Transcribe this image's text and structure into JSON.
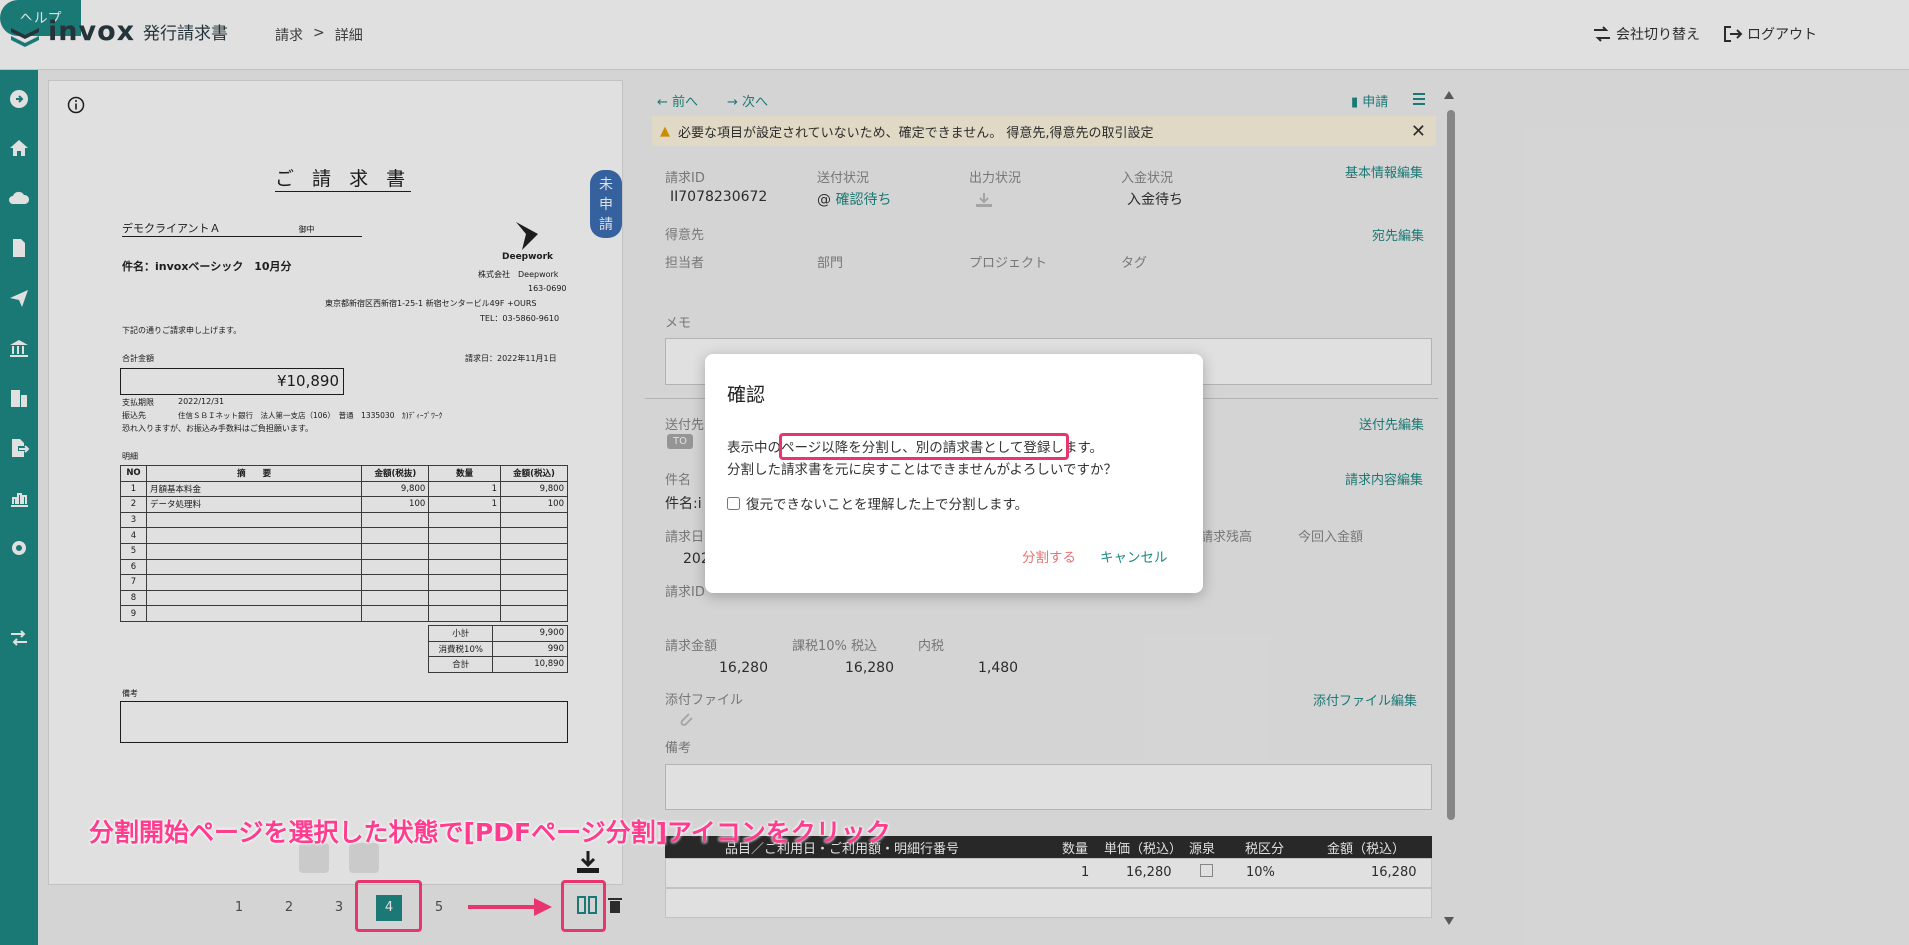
{
  "header": {
    "brand": "invox",
    "brand_sub": "発行請求書",
    "breadcrumb": [
      "請求",
      ">",
      "詳細"
    ],
    "switch_company": "会社切り替え",
    "logout": "ログアウト",
    "help": "ヘルプ"
  },
  "preview": {
    "status_badge": "未申請",
    "doc": {
      "title": "ご 請 求 書",
      "client": "デモクライアントＡ",
      "honorific": "御中",
      "subject": "件名：invoxベーシック　10月分",
      "company_logo": "Deepwork",
      "company_name": "株式会社　Deepwork",
      "postal": "163-0690",
      "address": "東京都新宿区西新宿1-25-1 新宿センタービル49F +OURS",
      "tel": "TEL：03-5860-9610",
      "intro": "下記の通りご請求申し上げます。",
      "total_label": "合計金額",
      "issue_date": "請求日：2022年11月1日",
      "total_amount": "¥10,890",
      "due_label": "支払期限",
      "due_date": "2022/12/31",
      "bank_label": "振込先",
      "bank_info": "住信ＳＢＩネット銀行　法人第一支店（106）　普通　1335030　ｶ)ﾃﾞｨｰﾌﾟﾜｰｸ",
      "fee_note": "恐れ入りますが、お振込み手数料はご負担願います。",
      "detail_label": "明細",
      "table_headers": [
        "NO",
        "摘　　要",
        "金額(税抜)",
        "数量",
        "金額(税込)"
      ],
      "rows": [
        [
          "1",
          "月額基本料金",
          "9,800",
          "1",
          "9,800"
        ],
        [
          "2",
          "データ処理料",
          "100",
          "1",
          "100"
        ],
        [
          "3",
          "",
          "",
          "",
          ""
        ],
        [
          "4",
          "",
          "",
          "",
          ""
        ],
        [
          "5",
          "",
          "",
          "",
          ""
        ],
        [
          "6",
          "",
          "",
          "",
          ""
        ],
        [
          "7",
          "",
          "",
          "",
          ""
        ],
        [
          "8",
          "",
          "",
          "",
          ""
        ],
        [
          "9",
          "",
          "",
          "",
          ""
        ]
      ],
      "summary": [
        [
          "小計",
          "9,900"
        ],
        [
          "消費税10%",
          "990"
        ],
        [
          "合計",
          "10,890"
        ]
      ],
      "remarks_label": "備考"
    },
    "pages": [
      "1",
      "2",
      "3",
      "4",
      "5"
    ],
    "active_page": "4"
  },
  "right": {
    "prev": "前へ",
    "next": "次へ",
    "apply": "申請",
    "warning": "必要な項目が設定されていないため、確定できません。 得意先,得意先の取引設定",
    "fields": {
      "invoice_id_label": "請求ID",
      "invoice_id": "II7078230672",
      "send_status_label": "送付状況",
      "send_status": "確認待ち",
      "output_status_label": "出力状況",
      "payment_status_label": "入金状況",
      "payment_status": "入金待ち",
      "edit_basic": "基本情報編集",
      "customer_label": "得意先",
      "edit_recipient": "宛先編集",
      "person_label": "担当者",
      "department_label": "部門",
      "project_label": "プロジェクト",
      "tag_label": "タグ",
      "memo_label": "メモ",
      "send_to_label": "送付先",
      "to_badge": "TO",
      "edit_send_to": "送付先編集",
      "subject_label": "件名",
      "subject_value": "件名:i",
      "edit_invoice": "請求内容編集",
      "invoice_date_label": "請求日",
      "invoice_date_value": "202",
      "balance_label": "請求残高",
      "this_payment_label": "今回入金額",
      "invoice_id2_label": "請求ID",
      "amount_label": "請求金額",
      "amount": "16,280",
      "tax10_label": "課税10% 税込",
      "tax10": "16,280",
      "inner_tax_label": "内税",
      "inner_tax": "1,480",
      "attach_label": "添付ファイル",
      "edit_attach": "添付ファイル編集",
      "remarks_label": "備考"
    },
    "table": {
      "headers": [
        "品目／ご利用日・ご利用額・明細行番号",
        "数量",
        "単価（税込）",
        "源泉",
        "税区分",
        "金額（税込）"
      ],
      "row": [
        "",
        "1",
        "16,280",
        "",
        "10%",
        "16,280"
      ]
    }
  },
  "modal": {
    "title": "確認",
    "line1_pre": "表示中の",
    "line1_highlight": "ページ以降を分割し、別の請求書として登録",
    "line1_post": "します。",
    "line2": "分割した請求書を元に戻すことはできませんがよろしいですか？",
    "checkbox_label": "復元できないことを理解した上で分割します。",
    "split_button": "分割する",
    "cancel_button": "キャンセル"
  },
  "annotation": {
    "caption": "分割開始ページを選択した状態で[PDFページ分割]アイコンをクリック"
  },
  "colors": {
    "teal": "#1f8a86",
    "badge_blue": "#3d6fb6",
    "annotation_pink": "#e8356d",
    "warning_bg": "#fff8e1"
  }
}
